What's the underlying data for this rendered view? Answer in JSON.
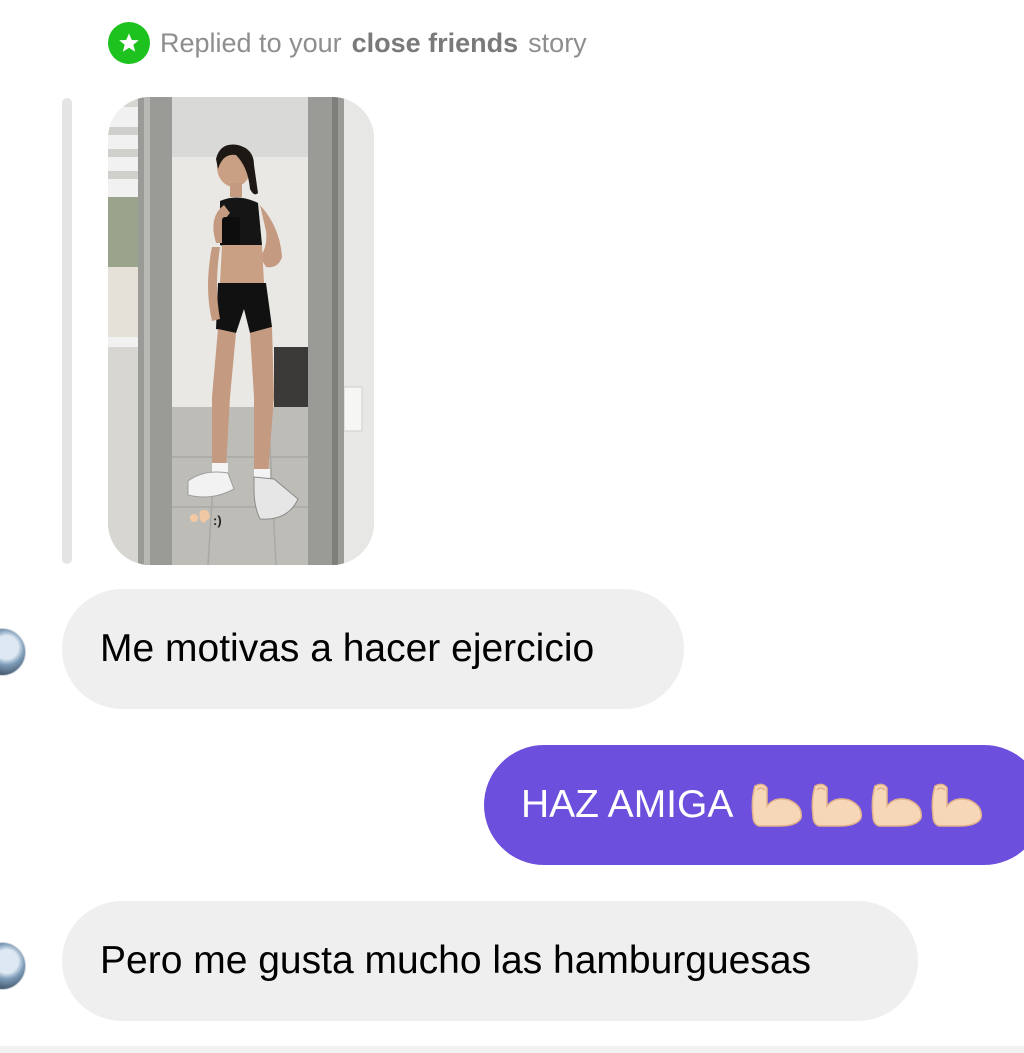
{
  "reply_header": {
    "prefix": "Replied to your",
    "highlight": "close friends",
    "suffix": "story",
    "badge_icon": "star-icon",
    "badge_color": "#1ec21e"
  },
  "story_reply": {
    "image_alt": "Mirror selfie of a woman in black workout clothes",
    "caption": ":)"
  },
  "messages": [
    {
      "direction": "incoming",
      "text": "Me motivas a hacer ejercicio"
    },
    {
      "direction": "outgoing",
      "text": "HAZ AMIGA",
      "emoji_icon": "flexed-biceps-icon",
      "emoji_count": "4"
    },
    {
      "direction": "incoming",
      "text": "Pero me gusta mucho las hamburguesas"
    }
  ],
  "colors": {
    "outgoing_bubble": "#6c4fdc",
    "incoming_bubble": "#efefef",
    "header_text": "#8e8e8e"
  }
}
